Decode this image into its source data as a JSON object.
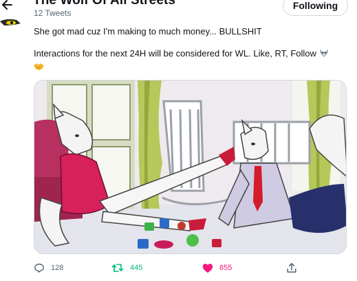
{
  "header": {
    "title": "The Wolf Of All Streets",
    "tweet_count": "12 Tweets",
    "follow_label": "Following"
  },
  "tweet": {
    "line1": "She got mad cuz I'm making to much money... BULLSHIT",
    "line2": "Interactions for the next 24H will be considered for WL. Like, RT, Follow",
    "trailing_emoji": "wolf-face-icon",
    "second_line_emoji": "handshake-icon"
  },
  "actions": {
    "reply_count": "128",
    "retweet_count": "445",
    "like_count": "855",
    "retweet_color": "#00ba7c",
    "like_color": "#f91880"
  },
  "colors": {
    "text": "#0f1419",
    "secondary": "#536471",
    "border": "#cfd9de"
  }
}
